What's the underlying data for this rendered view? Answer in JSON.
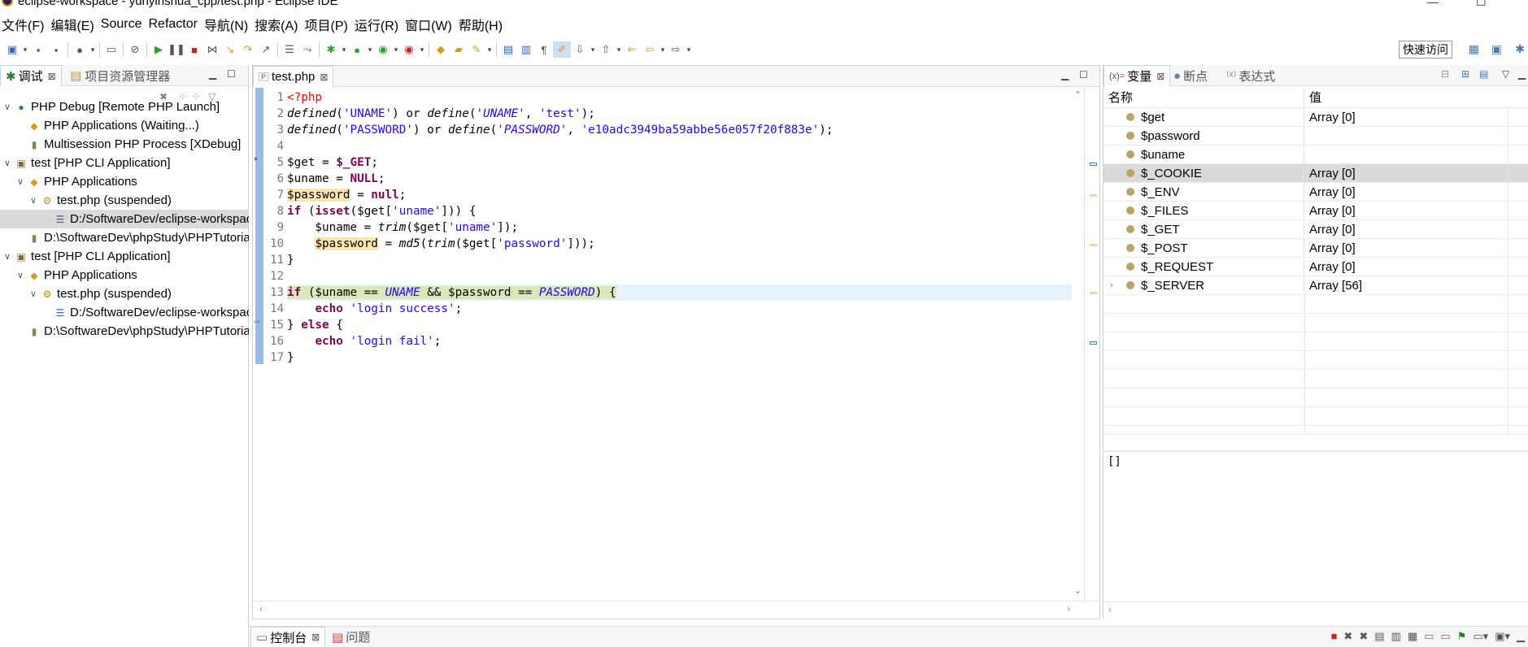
{
  "window": {
    "title": "eclipse-workspace - yunyinshua_cpp/test.php - Eclipse IDE",
    "minimize": "—",
    "maximize": "☐"
  },
  "menu": [
    "文件(F)",
    "编辑(E)",
    "Source",
    "Refactor",
    "导航(N)",
    "搜索(A)",
    "项目(P)",
    "运行(R)",
    "窗口(W)",
    "帮助(H)"
  ],
  "toolbar": {
    "quick_access": "快速访问"
  },
  "debug_view": {
    "tabs": [
      {
        "label": "调试",
        "close": "⊠"
      },
      {
        "label": "项目资源管理器"
      }
    ],
    "tree": [
      {
        "arrow": "∨",
        "icon": "php-debug-icon",
        "label": "PHP Debug [Remote PHP Launch]",
        "indent": 0
      },
      {
        "arrow": "",
        "icon": "php-app-icon",
        "label": "PHP Applications (Waiting...)",
        "indent": 1
      },
      {
        "arrow": "",
        "icon": "process-icon",
        "label": "Multisession PHP Process [XDebug]",
        "indent": 1
      },
      {
        "arrow": "∨",
        "icon": "php-cli-icon",
        "label": "test [PHP CLI Application]",
        "indent": 0
      },
      {
        "arrow": "∨",
        "icon": "php-app-icon",
        "label": "PHP Applications",
        "indent": 1
      },
      {
        "arrow": "∨",
        "icon": "thread-suspended-icon",
        "label": "test.php (suspended)",
        "indent": 2
      },
      {
        "arrow": "",
        "icon": "stack-frame-icon",
        "label": "D:/SoftwareDev/eclipse-workspace",
        "indent": 3,
        "selected": true
      },
      {
        "arrow": "",
        "icon": "process-icon",
        "label": "D:\\SoftwareDev\\phpStudy\\PHPTutorial",
        "indent": 1
      },
      {
        "arrow": "∨",
        "icon": "php-cli-icon",
        "label": "test [PHP CLI Application]",
        "indent": 0
      },
      {
        "arrow": "∨",
        "icon": "php-app-icon",
        "label": "PHP Applications",
        "indent": 1
      },
      {
        "arrow": "∨",
        "icon": "thread-suspended-icon",
        "label": "test.php (suspended)",
        "indent": 2
      },
      {
        "arrow": "",
        "icon": "stack-frame-icon",
        "label": "D:/SoftwareDev/eclipse-workspace",
        "indent": 3
      },
      {
        "arrow": "",
        "icon": "process-icon",
        "label": "D:\\SoftwareDev\\phpStudy\\PHPTutorial",
        "indent": 1
      }
    ]
  },
  "editor": {
    "tab": "test.php",
    "line_numbers": [
      "1",
      "2",
      "3",
      "4",
      "5",
      "6",
      "7",
      "8",
      "9",
      "10",
      "11",
      "12",
      "13",
      "14",
      "15",
      "16",
      "17"
    ]
  },
  "variables_view": {
    "tabs": [
      {
        "label": "变量",
        "close": "⊠"
      },
      {
        "label": "断点"
      },
      {
        "label": "表达式"
      }
    ],
    "columns": {
      "name": "名称",
      "value": "值"
    },
    "rows": [
      {
        "name": "$get",
        "value": "Array [0]",
        "expandable": false
      },
      {
        "name": "$password",
        "value": "",
        "expandable": false
      },
      {
        "name": "$uname",
        "value": "",
        "expandable": false
      },
      {
        "name": "$_COOKIE",
        "value": "Array [0]",
        "expandable": false,
        "selected": true
      },
      {
        "name": "$_ENV",
        "value": "Array [0]",
        "expandable": false
      },
      {
        "name": "$_FILES",
        "value": "Array [0]",
        "expandable": false
      },
      {
        "name": "$_GET",
        "value": "Array [0]",
        "expandable": false
      },
      {
        "name": "$_POST",
        "value": "Array [0]",
        "expandable": false
      },
      {
        "name": "$_REQUEST",
        "value": "Array [0]",
        "expandable": false
      },
      {
        "name": "$_SERVER",
        "value": "Array [56]",
        "expandable": true
      }
    ],
    "detail": "[]"
  },
  "bottom_panel": {
    "tabs": [
      {
        "label": "控制台",
        "close": "⊠"
      },
      {
        "label": "问题"
      }
    ]
  },
  "colors": {
    "keyword": "#7f0055",
    "string": "#2a00ff",
    "php_tag": "#ff0000",
    "selection": "#dadada",
    "current_line": "#e8f2fe"
  }
}
